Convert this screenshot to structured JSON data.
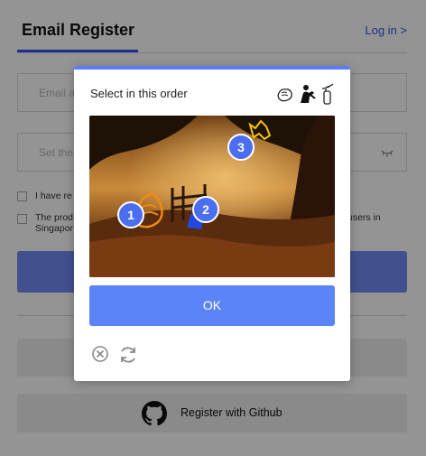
{
  "header": {
    "tab_title": "Email Register",
    "login_link": "Log in >"
  },
  "form": {
    "email_placeholder": "Email a",
    "password_placeholder": "Set the",
    "agree_text": "I have re",
    "product_text_a": "The prod",
    "product_text_b": "Singapor",
    "product_text_right": "users in"
  },
  "buttons": {
    "github_label": "Register with Github"
  },
  "captcha": {
    "title": "Select in this order",
    "ok_label": "OK",
    "markers": [
      "1",
      "2",
      "3"
    ],
    "hint_icons": [
      "clapping-hands-icon",
      "person-with-extinguisher-icon",
      "fire-extinguisher-icon"
    ]
  },
  "colors": {
    "accent": "#2f54eb",
    "captcha_accent": "#5b84f8",
    "marker": "#4b6ef0"
  }
}
